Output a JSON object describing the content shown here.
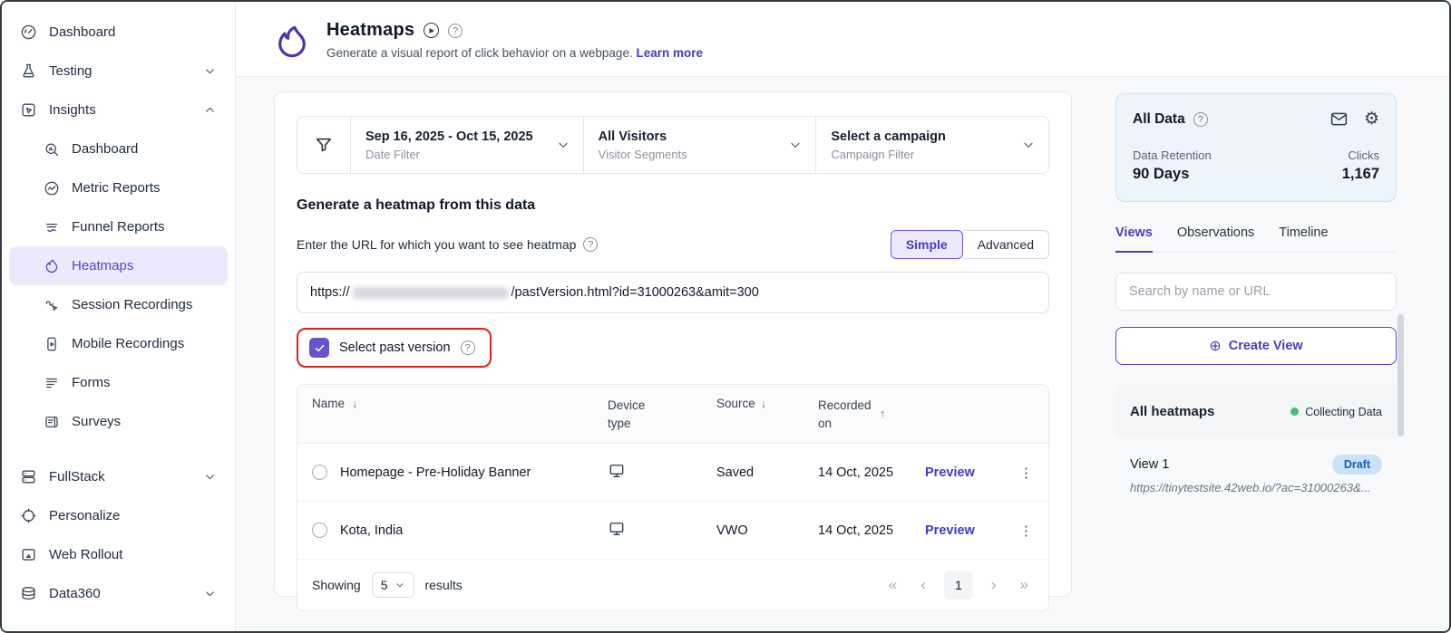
{
  "sidebar": {
    "top": [
      {
        "label": "Dashboard"
      },
      {
        "label": "Testing"
      },
      {
        "label": "Insights"
      }
    ],
    "insights_children": [
      {
        "label": "Dashboard"
      },
      {
        "label": "Metric Reports"
      },
      {
        "label": "Funnel Reports"
      },
      {
        "label": "Heatmaps"
      },
      {
        "label": "Session Recordings"
      },
      {
        "label": "Mobile Recordings"
      },
      {
        "label": "Forms"
      },
      {
        "label": "Surveys"
      }
    ],
    "bottom": [
      {
        "label": "FullStack"
      },
      {
        "label": "Personalize"
      },
      {
        "label": "Web Rollout"
      },
      {
        "label": "Data360"
      }
    ]
  },
  "header": {
    "title": "Heatmaps",
    "subtitle": "Generate a visual report of click behavior on a webpage.",
    "learn_more": "Learn more"
  },
  "filters": {
    "date": {
      "value": "Sep 16, 2025 - Oct 15, 2025",
      "label": "Date Filter"
    },
    "segments": {
      "value": "All Visitors",
      "label": "Visitor Segments"
    },
    "campaign": {
      "value": "Select a campaign",
      "label": "Campaign Filter"
    }
  },
  "generate": {
    "heading": "Generate a heatmap from this data",
    "url_label": "Enter the URL for which you want to see heatmap",
    "toggle": {
      "simple": "Simple",
      "advanced": "Advanced"
    },
    "url_prefix": "https://",
    "url_suffix": "/pastVersion.html?id=31000263&amit=300",
    "checkbox_label": "Select past version"
  },
  "table": {
    "headers": {
      "name": "Name",
      "device": "Device type",
      "source": "Source",
      "recorded": "Recorded on"
    },
    "rows": [
      {
        "name": "Homepage - Pre-Holiday Banner",
        "source": "Saved",
        "date": "14 Oct, 2025",
        "action": "Preview"
      },
      {
        "name": "Kota, India",
        "source": "VWO",
        "date": "14 Oct, 2025",
        "action": "Preview"
      }
    ],
    "footer": {
      "showing": "Showing",
      "per_page": "5",
      "results": "results",
      "page": "1"
    }
  },
  "panel": {
    "all_data": {
      "title": "All Data",
      "retention_label": "Data Retention",
      "retention_value": "90 Days",
      "clicks_label": "Clicks",
      "clicks_value": "1,167"
    },
    "tabs": [
      {
        "label": "Views"
      },
      {
        "label": "Observations"
      },
      {
        "label": "Timeline"
      }
    ],
    "search_placeholder": "Search by name or URL",
    "create_view": "Create View",
    "all_heatmaps": {
      "label": "All heatmaps",
      "status": "Collecting Data"
    },
    "view": {
      "name": "View 1",
      "badge": "Draft",
      "url": "https://tinytestsite.42web.io/?ac=31000263&..."
    }
  },
  "colors": {
    "accent_purple": "#5B43C4",
    "link_indigo": "#4338CA",
    "annotation_red": "#E21F1F",
    "status_green": "#3BC07F",
    "alldata_bg": "#EDF5FC",
    "draft_badge_bg": "#C9E2F9"
  }
}
